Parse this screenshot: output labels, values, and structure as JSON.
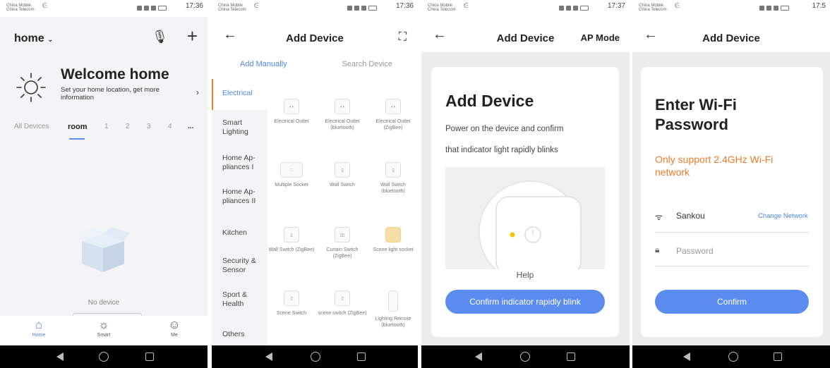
{
  "status": {
    "carrier1": "China Mobile",
    "carrier2": "China Telecom",
    "time1": "17:36",
    "time2": "17:36",
    "time3": "17:37",
    "time4": "17:5"
  },
  "screen1": {
    "home_label": "home",
    "welcome_title": "Welcome home",
    "welcome_sub": "Set your home location, get more information",
    "tabs": [
      "All Devices",
      "room",
      "1",
      "2",
      "3",
      "4",
      "..."
    ],
    "empty_label": "No device",
    "tabbar": [
      {
        "label": "Home",
        "icon": "home-icon"
      },
      {
        "label": "Smart",
        "icon": "sun-icon"
      },
      {
        "label": "Me",
        "icon": "user-icon"
      }
    ]
  },
  "screen2": {
    "title": "Add Device",
    "subtabs": [
      "Add Manually",
      "Search Device"
    ],
    "categories": [
      "Electrical",
      "Smart Lighting",
      "Home Ap- pliances I",
      "Home Ap- pliances II",
      "Kitchen",
      "Security & Sensor",
      "Sport & Health",
      "Others"
    ],
    "devices": [
      "Electrical Outlet",
      "Electrical Outlet (bluetooth)",
      "Electrical Outlet (ZigBee)",
      "Multiple Socket",
      "Wall Switch",
      "Wall Switch (bluetooth)",
      "Wall Switch (ZigBee)",
      "Curtain Switch (ZigBee)",
      "Scene light socket",
      "Scene Switch",
      "scene switch (ZigBee)",
      "Lighting Remote (bluetooth)"
    ]
  },
  "screen3": {
    "title": "Add Device",
    "mode": "AP Mode",
    "heading": "Add Device",
    "line1": "Power on the device and confirm",
    "line2": "that indicator light rapidly blinks",
    "help": "Help",
    "button": "Confirm indicator rapidly blink"
  },
  "screen4": {
    "title": "Add Device",
    "heading": "Enter Wi-Fi Password",
    "warning": "Only support 2.4GHz Wi-Fi network",
    "ssid": "Sankou",
    "change": "Change Network",
    "password_placeholder": "Password",
    "button": "Confirm"
  },
  "colors": {
    "accent": "#5b8cf0",
    "warning": "#f27b28"
  }
}
